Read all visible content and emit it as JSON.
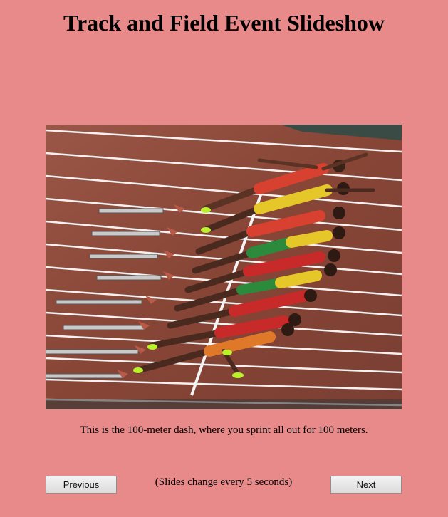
{
  "page": {
    "title": "Track and Field Event Slideshow"
  },
  "slide": {
    "icon": "sprinters-start-photo",
    "caption": "This is the 100-meter dash, where you sprint all out for 100 meters."
  },
  "controls": {
    "previous_label": "Previous",
    "next_label": "Next",
    "interval_note": "(Slides change every 5 seconds)"
  },
  "colors": {
    "background": "#e88a8a",
    "track": "#8a4a3e"
  }
}
